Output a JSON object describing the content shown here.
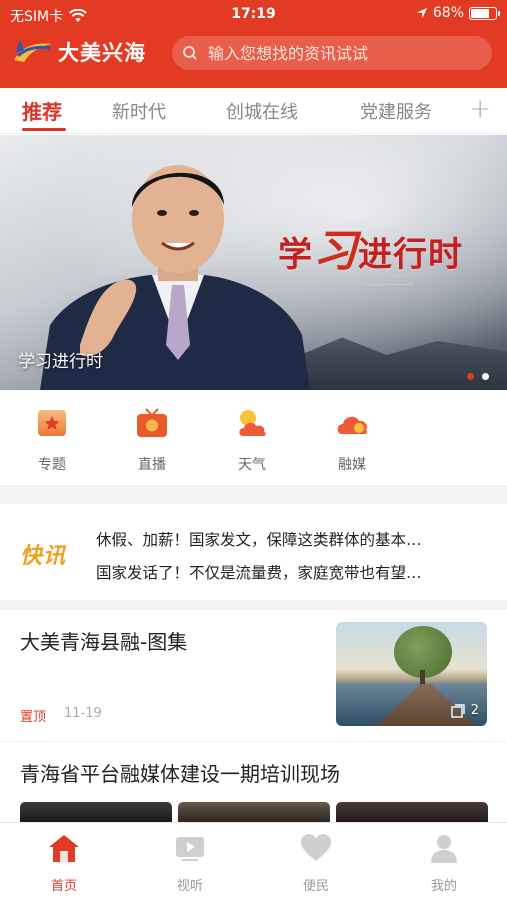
{
  "status_bar": {
    "carrier": "无SIM卡",
    "time": "17:19",
    "battery": "68%",
    "battery_level": 0.68
  },
  "header": {
    "app_name": "大美兴海",
    "search_placeholder": "输入您想找的资讯试试"
  },
  "tabs": [
    "推荐",
    "新时代",
    "创城在线",
    "党建服务"
  ],
  "tab_add": "+",
  "banner": {
    "slogan_a": "学",
    "slogan_b": "习",
    "slogan_c": "进行时",
    "caption": "学习进行时",
    "slides": 2,
    "active_slide": 1
  },
  "quick_links": [
    {
      "label": "专题",
      "icon": "star-icon"
    },
    {
      "label": "直播",
      "icon": "tv-icon"
    },
    {
      "label": "天气",
      "icon": "weather-icon"
    },
    {
      "label": "融媒",
      "icon": "cloud-icon"
    }
  ],
  "news_flash": {
    "logo": "快讯",
    "items": [
      "休假、加薪！国家发文，保障这类群体的基本…",
      "国家发话了！不仅是流量费，家庭宽带也有望…"
    ]
  },
  "articles": [
    {
      "title": "大美青海县融-图集",
      "tag": "置顶",
      "date": "11-19",
      "image_count": "2"
    },
    {
      "title": "青海省平台融媒体建设一期培训现场"
    }
  ],
  "bottom_nav": [
    {
      "label": "首页",
      "icon": "home-icon"
    },
    {
      "label": "视听",
      "icon": "video-icon"
    },
    {
      "label": "便民",
      "icon": "heart-icon"
    },
    {
      "label": "我的",
      "icon": "user-icon"
    }
  ],
  "colors": {
    "brand": "#e33b23",
    "accent_orange": "#f0a020"
  }
}
